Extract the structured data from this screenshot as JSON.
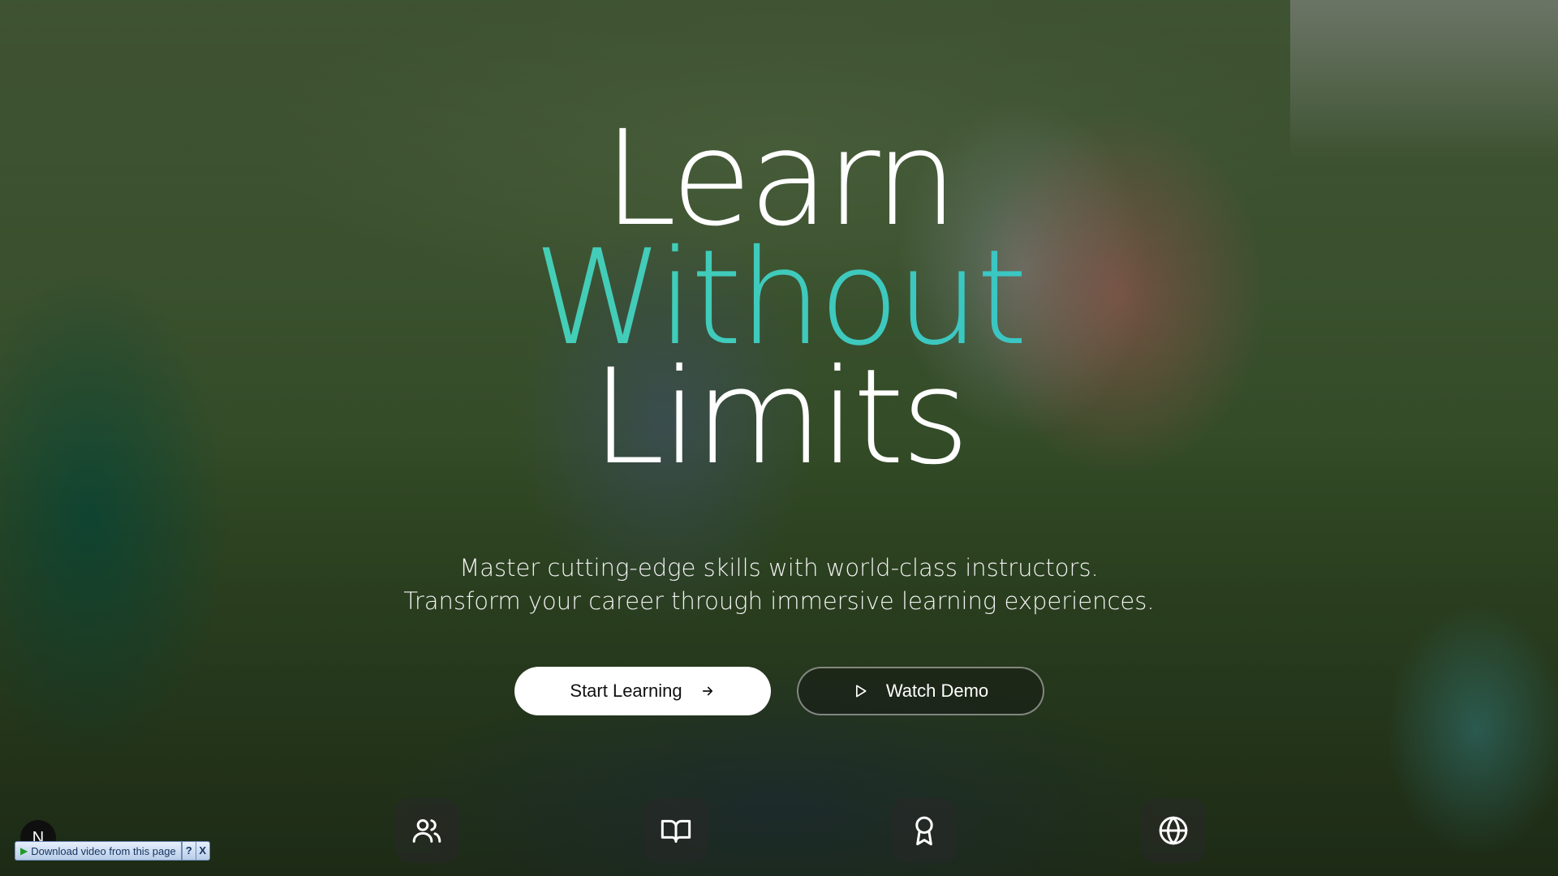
{
  "hero": {
    "line1": "Learn",
    "line2": "Without",
    "line3": "Limits",
    "subtitle_line1": "Master cutting-edge skills with world-class instructors.",
    "subtitle_line2": "Transform your career through immersive learning experiences."
  },
  "actions": {
    "primary_label": "Start Learning",
    "secondary_label": "Watch Demo"
  },
  "features": {
    "icons": [
      "users-icon",
      "book-open-icon",
      "award-icon",
      "globe-icon"
    ]
  },
  "badge": {
    "letter": "N"
  },
  "download_bar": {
    "label": "Download video from this page",
    "help": "?",
    "close": "X"
  },
  "colors": {
    "accent_gradient_start": "#4fd6a9",
    "accent_gradient_end": "#35b7d4",
    "primary_button_bg": "#ffffff"
  }
}
